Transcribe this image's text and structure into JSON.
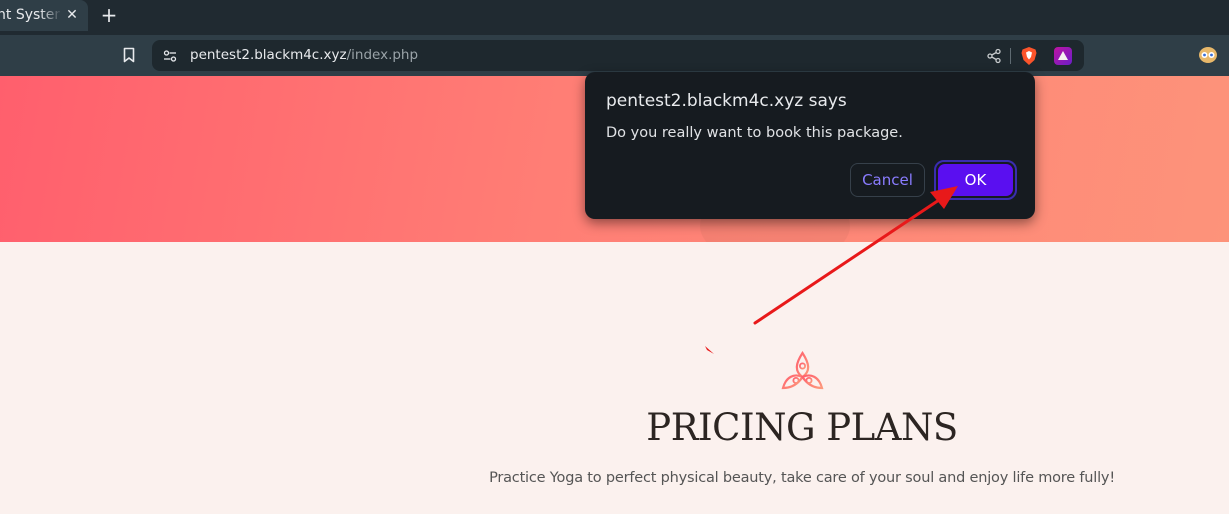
{
  "browser": {
    "tab": {
      "title": "nt System"
    },
    "address_bar": {
      "host": "pentest2.blackm4c.xyz",
      "path": "/index.php"
    }
  },
  "page": {
    "pricing": {
      "title": "PRICING PLANS",
      "subtitle": "Practice Yoga to perfect physical beauty, take care of your soul and enjoy life more fully!"
    }
  },
  "dialog": {
    "title": "pentest2.blackm4c.xyz says",
    "message": "Do you really want to book this package.",
    "cancel_label": "Cancel",
    "ok_label": "OK"
  },
  "colors": {
    "hero_start": "#ff5f6d",
    "hero_end": "#fd937a",
    "ok_button": "#5a0ff0",
    "annotation_arrow": "#e8191a"
  },
  "icons": {
    "tab_close": "close-icon",
    "new_tab": "plus-icon",
    "bookmark": "bookmark-icon",
    "site_info": "site-settings-icon",
    "share": "share-icon",
    "shield": "brave-shield-icon",
    "rewards": "brave-rewards-icon",
    "profile": "profile-avatar-icon",
    "section": "lotus-icon"
  }
}
